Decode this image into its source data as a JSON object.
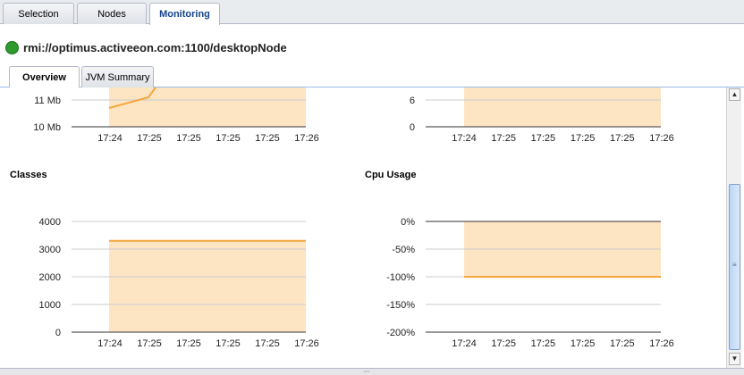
{
  "top_tabs": [
    {
      "label": "Selection",
      "active": false
    },
    {
      "label": "Nodes",
      "active": false
    },
    {
      "label": "Monitoring",
      "active": true
    }
  ],
  "node": {
    "status": "online",
    "status_color": "#2c9b2c",
    "label": "rmi://optimus.activeeon.com:1100/desktopNode"
  },
  "sub_tabs": [
    {
      "label": "Overview",
      "active": true
    },
    {
      "label": "JVM Summary",
      "active": false
    }
  ],
  "colors": {
    "fill": "#fde5c4",
    "line": "#f5a53c",
    "grid": "#cccccc"
  },
  "chart_data": [
    {
      "type": "area",
      "title": "",
      "x": [
        "17:24",
        "17:25",
        "17:25",
        "17:25",
        "17:25",
        "17:26"
      ],
      "y_ticks": [
        "10 Mb",
        "11 Mb"
      ],
      "ylim": [
        10,
        11.8
      ],
      "series": [
        {
          "values": [
            10.7,
            11.1,
            11.8
          ]
        }
      ],
      "note_partial": true
    },
    {
      "type": "area",
      "title": "",
      "x": [
        "17:24",
        "17:25",
        "17:25",
        "17:25",
        "17:25",
        "17:26"
      ],
      "y_ticks": [
        "0",
        "6"
      ],
      "ylim": [
        0,
        9.6
      ],
      "series": [
        {
          "values": [
            9.6,
            9.6
          ]
        }
      ]
    },
    {
      "type": "area",
      "title": "Classes",
      "x": [
        "17:24",
        "17:25",
        "17:25",
        "17:25",
        "17:25",
        "17:26"
      ],
      "y_ticks": [
        "0",
        "1000",
        "2000",
        "3000",
        "4000"
      ],
      "ylim": [
        0,
        4000
      ],
      "series": [
        {
          "values": [
            3300,
            3300
          ]
        }
      ]
    },
    {
      "type": "area",
      "title": "Cpu Usage",
      "x": [
        "17:24",
        "17:25",
        "17:25",
        "17:25",
        "17:25",
        "17:26"
      ],
      "y_ticks": [
        "-200%",
        "-150%",
        "-100%",
        "-50%",
        "0%"
      ],
      "ylim": [
        -200,
        0
      ],
      "series": [
        {
          "values": [
            -100,
            -100
          ]
        }
      ]
    }
  ]
}
